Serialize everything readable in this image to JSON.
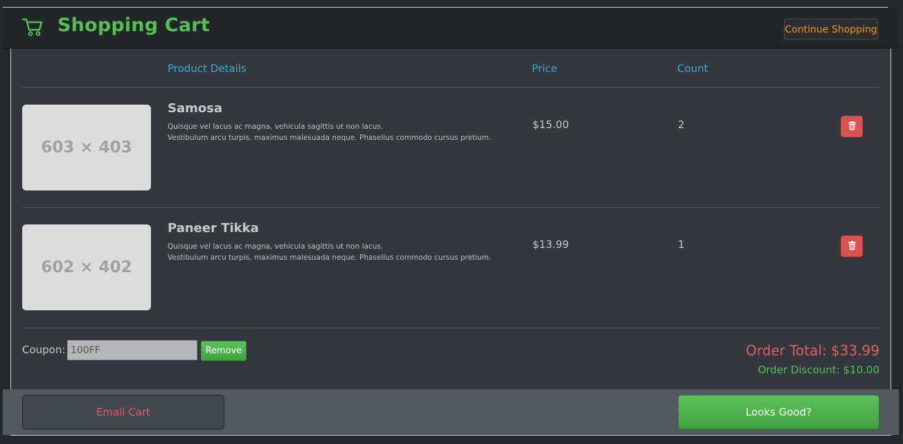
{
  "header": {
    "title": "Shopping Cart",
    "continue_label": "Continue Shopping",
    "icon": "cart-icon",
    "accent": "#52c050"
  },
  "table": {
    "columns": [
      "Product Details",
      "Price",
      "Count"
    ],
    "items": [
      {
        "thumb_text": "603 × 403",
        "name": "Samosa",
        "desc_line1": "Quisque vel lacus ac magna, vehicula sagittis ut non lacus.",
        "desc_line2": "Vestibulum arcu turpis, maximus malesuada neque. Phasellus commodo cursus pretium.",
        "price": "$15.00",
        "count": "2",
        "delete_icon": "trash-icon"
      },
      {
        "thumb_text": "602 × 402",
        "name": "Paneer Tikka",
        "desc_line1": "Quisque vel lacus ac magna, vehicula sagittis ut non lacus.",
        "desc_line2": "Vestibulum arcu turpis, maximus malesuada neque. Phasellus commodo cursus pretium.",
        "price": "$13.99",
        "count": "1",
        "delete_icon": "trash-icon"
      }
    ]
  },
  "coupon": {
    "label": "Coupon:",
    "value": "100FF",
    "remove_label": "Remove"
  },
  "summary": {
    "order_total": "Order Total: $33.99",
    "order_discount": "Order Discount: $10.00"
  },
  "footer": {
    "email_label": "Email Cart",
    "confirm_label": "Looks Good?"
  },
  "colors": {
    "danger": "#d9534f",
    "success": "#52c050",
    "link": "#3ba9d4",
    "warning": "#f0921c"
  }
}
